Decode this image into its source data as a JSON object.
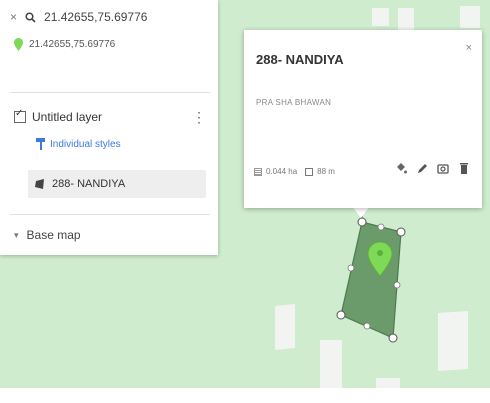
{
  "search": {
    "close_glyph": "×",
    "icon": "search-icon",
    "query": "21.42655,75.69776"
  },
  "result": {
    "icon": "green-pin-icon",
    "coordinates": "21.42655,75.69776"
  },
  "layer": {
    "name": "Untitled layer",
    "checked": true,
    "menu_glyph": "⋮",
    "styles_label": "Individual styles",
    "feature_label": "288- NANDIYA"
  },
  "basemap": {
    "caret": "▾",
    "label": "Base map"
  },
  "popup": {
    "title": "288- NANDIYA",
    "close_glyph": "×",
    "description": "PRA SHA BHAWAN",
    "area": "0.044 ha",
    "perimeter": "88 m",
    "actions": [
      "style-bucket-icon",
      "edit-pencil-icon",
      "camera-icon",
      "trash-icon"
    ]
  },
  "colors": {
    "map_background": "#cfeccf",
    "polygon_fill": "#6b9a6b",
    "pin": "#7ed957",
    "link": "#3b7be0"
  }
}
